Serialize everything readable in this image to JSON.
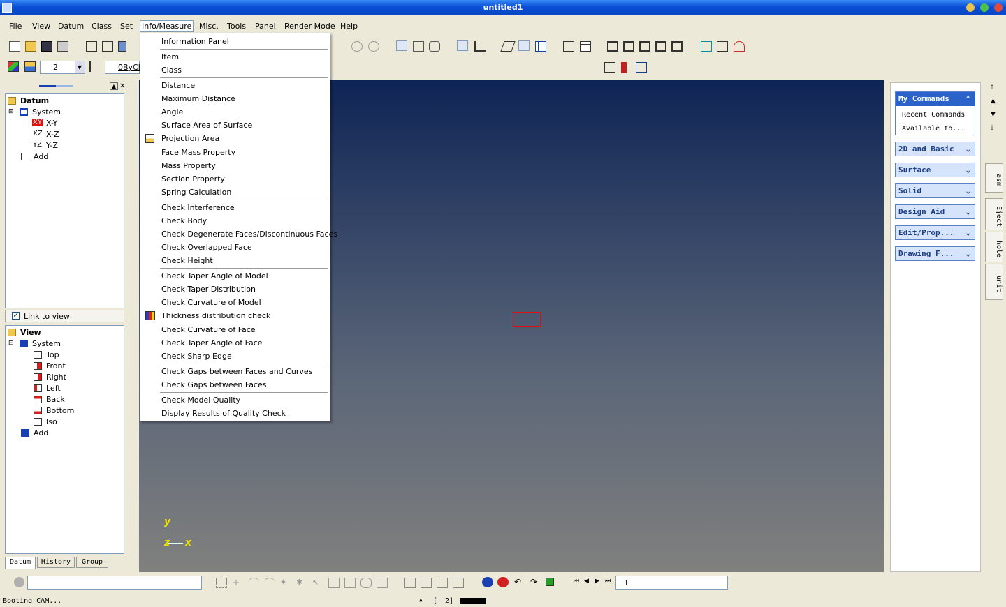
{
  "window": {
    "title": "untitled1"
  },
  "menu": [
    "File",
    "View",
    "Datum",
    "Class",
    "Set",
    "Info/Measure",
    "Misc.",
    "Tools",
    "Panel",
    "Render Mode",
    "Help"
  ],
  "toolbar2": {
    "layer": "2",
    "linestyle": "0ByCl"
  },
  "dropdown": {
    "items": [
      "Information Panel",
      "Item",
      "Class",
      "Distance",
      "Maximum Distance",
      "Angle",
      "Surface Area of Surface",
      "Projection Area",
      "Face Mass Property",
      "Mass Property",
      "Section Property",
      "Spring Calculation",
      "Check Interference",
      "Check Body",
      "Check Degenerate Faces/Discontinuous Faces",
      "Check Overlapped Face",
      "Check Height",
      "Check Taper Angle of Model",
      "Check Taper Distribution",
      "Check Curvature of Model",
      "Thickness distribution check",
      "Check Curvature of Face",
      "Check Taper Angle of Face",
      "Check Sharp Edge",
      "Check Gaps between Faces and Curves",
      "Check Gaps between Faces",
      "Check Model Quality",
      "Display Results of Quality Check"
    ]
  },
  "datum_tree": {
    "root": "Datum",
    "system": "System",
    "items": [
      {
        "tag": "XY",
        "label": "X-Y"
      },
      {
        "tag": "XZ",
        "label": "X-Z"
      },
      {
        "tag": "YZ",
        "label": "Y-Z"
      }
    ],
    "add": "Add",
    "link": "Link to view"
  },
  "view_tree": {
    "root": "View",
    "system": "System",
    "items": [
      "Top",
      "Front",
      "Right",
      "Left",
      "Back",
      "Bottom",
      "Iso"
    ],
    "add": "Add"
  },
  "left_tabs": [
    "Datum",
    "History",
    "Group"
  ],
  "axes": {
    "y": "y",
    "z": "z",
    "x": "x"
  },
  "right_panel": {
    "my_commands": "My Commands",
    "recent": "Recent Commands",
    "available": "Available to...",
    "groups": [
      "2D and Basic",
      "Surface",
      "Solid",
      "Design Aid",
      "Edit/Prop...",
      "Drawing F..."
    ]
  },
  "vtabs": [
    "asm",
    "Eject",
    "hole",
    "unit"
  ],
  "bottom": {
    "page": "1"
  },
  "status": {
    "text": "Booting CAM...",
    "bracket": "[",
    "count": "2]"
  },
  "colors": {
    "title": "#0a4ed6",
    "viewport_top": "#0e2455",
    "viewport_bottom": "#80807e",
    "accent": "#1a3f86"
  }
}
